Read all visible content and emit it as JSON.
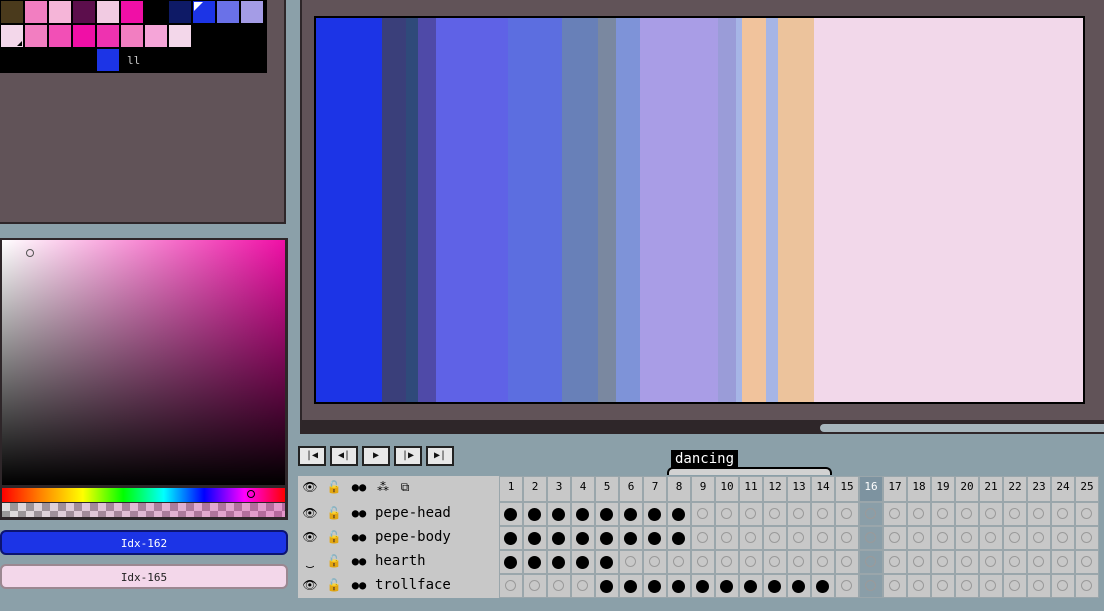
{
  "palette": {
    "colors": [
      "#4a3a1c",
      "#f27ec1",
      "#f5b5d8",
      "#5c0e4c",
      "#f1cbe2",
      "#f00fa6",
      "#000000",
      "#0e1a66",
      "#1c34e6",
      "#6a71e8",
      "#a49ce6",
      "#f3d7ea",
      "#f27ec1",
      "#f24fb6",
      "#f00fa6",
      "#ee32b0",
      "#f27ec1",
      "#f5a5d8",
      "#f3d7ea",
      "#000000",
      "#000000",
      "#000000",
      "#000000",
      "#000000",
      "#000000",
      "#000000",
      "#1c34e6"
    ],
    "handle": "ll"
  },
  "colors": {
    "fg_label": "Idx-162",
    "bg_label": "Idx-165",
    "fg": "#1c34e6",
    "bg": "#f3d7ea"
  },
  "canvas": {
    "stripes": [
      "#1c34e6",
      "#3a3f7a",
      "#2f4a7a",
      "#4f4aa8",
      "#5f62e6",
      "#5c6ee0",
      "#6880b8",
      "#7a88a0",
      "#7e93d8",
      "#a99de6",
      "#9a9cd8",
      "#a6b5e6",
      "#f1c39c",
      "#a6b5e6",
      "#ecc39c",
      "#f2d8ea"
    ]
  },
  "playback": {
    "first": "|◀",
    "prev": "◀|",
    "play": "▶",
    "next": "|▶",
    "last": "▶|"
  },
  "tag": {
    "label": "dancing"
  },
  "timeline": {
    "frames": [
      "1",
      "2",
      "3",
      "4",
      "5",
      "6",
      "7",
      "8",
      "9",
      "10",
      "11",
      "12",
      "13",
      "14",
      "15",
      "16",
      "17",
      "18",
      "19",
      "20",
      "21",
      "22",
      "23",
      "24",
      "25"
    ],
    "active_frame": 16,
    "header_icons": [
      "eye-icon",
      "lock-icon",
      "onion-skin-icon",
      "link-icon",
      "frame-icon"
    ],
    "layers": [
      {
        "name": "pepe-head",
        "visible": true,
        "cels": [
          1,
          1,
          1,
          1,
          1,
          1,
          1,
          1,
          0,
          0,
          0,
          0,
          0,
          0,
          0,
          0,
          0,
          0,
          0,
          0,
          0,
          0,
          0,
          0,
          0
        ]
      },
      {
        "name": "pepe-body",
        "visible": true,
        "cels": [
          1,
          1,
          1,
          1,
          1,
          1,
          1,
          1,
          0,
          0,
          0,
          0,
          0,
          0,
          0,
          0,
          0,
          0,
          0,
          0,
          0,
          0,
          0,
          0,
          0
        ]
      },
      {
        "name": "hearth",
        "visible": false,
        "cels": [
          1,
          1,
          1,
          1,
          1,
          0,
          0,
          0,
          0,
          0,
          0,
          0,
          0,
          0,
          0,
          0,
          0,
          0,
          0,
          0,
          0,
          0,
          0,
          0,
          0
        ]
      },
      {
        "name": "trollface",
        "visible": true,
        "cels": [
          0,
          0,
          0,
          0,
          1,
          1,
          1,
          1,
          1,
          1,
          1,
          1,
          1,
          1,
          0,
          0,
          0,
          0,
          0,
          0,
          0,
          0,
          0,
          0,
          0
        ]
      }
    ]
  }
}
